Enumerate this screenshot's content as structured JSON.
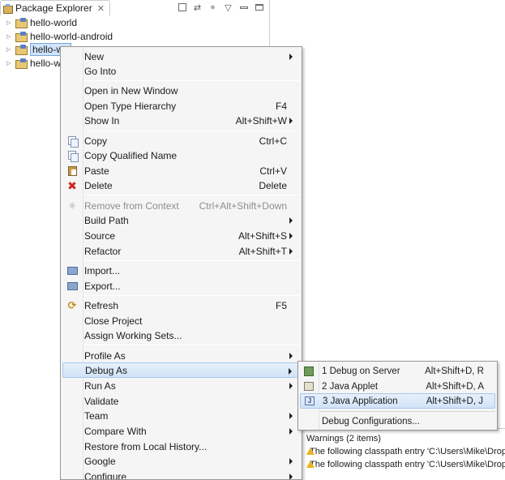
{
  "explorer": {
    "tab_label": "Package Explorer",
    "tab_close": "✕",
    "projects": [
      "hello-world",
      "hello-world-android",
      "hello-wo",
      "hello-wo"
    ]
  },
  "context_menu": {
    "items": [
      {
        "label": "New",
        "accel": ""
      },
      {
        "label": "Go Into",
        "accel": ""
      },
      {
        "label": "Open in New Window",
        "accel": ""
      },
      {
        "label": "Open Type Hierarchy",
        "accel": "F4"
      },
      {
        "label": "Show In",
        "accel": "Alt+Shift+W"
      },
      {
        "label": "Copy",
        "accel": "Ctrl+C"
      },
      {
        "label": "Copy Qualified Name",
        "accel": ""
      },
      {
        "label": "Paste",
        "accel": "Ctrl+V"
      },
      {
        "label": "Delete",
        "accel": "Delete"
      },
      {
        "label": "Remove from Context",
        "accel": "Ctrl+Alt+Shift+Down"
      },
      {
        "label": "Build Path",
        "accel": ""
      },
      {
        "label": "Source",
        "accel": "Alt+Shift+S"
      },
      {
        "label": "Refactor",
        "accel": "Alt+Shift+T"
      },
      {
        "label": "Import...",
        "accel": ""
      },
      {
        "label": "Export...",
        "accel": ""
      },
      {
        "label": "Refresh",
        "accel": "F5"
      },
      {
        "label": "Close Project",
        "accel": ""
      },
      {
        "label": "Assign Working Sets...",
        "accel": ""
      },
      {
        "label": "Profile As",
        "accel": ""
      },
      {
        "label": "Debug As",
        "accel": ""
      },
      {
        "label": "Run As",
        "accel": ""
      },
      {
        "label": "Validate",
        "accel": ""
      },
      {
        "label": "Team",
        "accel": ""
      },
      {
        "label": "Compare With",
        "accel": ""
      },
      {
        "label": "Restore from Local History...",
        "accel": ""
      },
      {
        "label": "Google",
        "accel": ""
      },
      {
        "label": "Configure",
        "accel": ""
      }
    ]
  },
  "debug_submenu": {
    "items": [
      {
        "label": "1 Debug on Server",
        "accel": "Alt+Shift+D, R"
      },
      {
        "label": "2 Java Applet",
        "accel": "Alt+Shift+D, A"
      },
      {
        "label": "3 Java Application",
        "accel": "Alt+Shift+D, J"
      },
      {
        "label": "Debug Configurations...",
        "accel": ""
      }
    ],
    "japp_glyph": "J"
  },
  "problems": {
    "header": "Warnings (2 items)",
    "items": [
      "The following classpath entry 'C:\\Users\\Mike\\Drop",
      "The following classpath entry 'C:\\Users\\Mike\\Drop"
    ]
  },
  "colors": {
    "highlight_border": "#a6c7ec",
    "menu_background": "#f5f5f5",
    "delete_red": "#d0281f"
  }
}
